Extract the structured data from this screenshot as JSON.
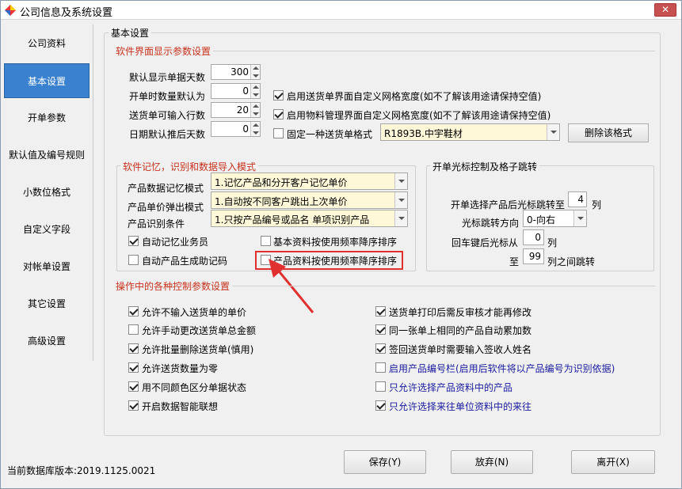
{
  "window": {
    "title": "公司信息及系统设置",
    "close": "✕"
  },
  "nav": [
    "公司资料",
    "基本设置",
    "开单参数",
    "默认值及编号规则",
    "小数位格式",
    "自定义字段",
    "对帐单设置",
    "其它设置",
    "高级设置"
  ],
  "nav_active": "基本设置",
  "main_title": "基本设置",
  "display_section": {
    "title": "软件界面显示参数设置",
    "rows": [
      {
        "label": "默认显示单据天数",
        "value": "300"
      },
      {
        "label": "开单时数量默认为",
        "value": "0"
      },
      {
        "label": "送货单可输入行数",
        "value": "20"
      },
      {
        "label": "日期默认推后天数",
        "value": "0"
      }
    ],
    "checks": [
      {
        "label": "启用送货单界面自定义网格宽度(如不了解该用途请保持空值)",
        "checked": true
      },
      {
        "label": "启用物料管理界面自定义网格宽度(如不了解该用途请保持空值)",
        "checked": true
      },
      {
        "label": "固定一种送货单格式",
        "checked": false
      }
    ],
    "format_value": "R1893B.中宇鞋材",
    "delete_format": "删除该格式"
  },
  "memory_section": {
    "title": "软件记忆，识别和数据导入模式",
    "rows": [
      {
        "label": "产品数据记忆模式",
        "value": "1.记忆产品和分开客户记忆单价"
      },
      {
        "label": "产品单价弹出模式",
        "value": "1.自动按不同客户跳出上次单价"
      },
      {
        "label": "产品识别条件",
        "value": "1.只按产品编号或品名 单项识别产品"
      }
    ],
    "checks": [
      {
        "label": "自动记忆业务员",
        "checked": true
      },
      {
        "label": "基本资料按使用频率降序排序",
        "checked": false
      },
      {
        "label": "自动产品生成助记码",
        "checked": false
      },
      {
        "label": "产品资料按使用频率降序排序",
        "checked": false
      }
    ]
  },
  "cursor_section": {
    "title": "开单光标控制及格子跳转",
    "row1_label": "开单选择产品后光标跳转至",
    "row1_value": "4",
    "row1_unit": "列",
    "row2_label": "光标跳转方向",
    "row2_value": "0-向右",
    "row3_label": "回车键后光标从",
    "row3_value": "0",
    "row3_unit": "列",
    "row4_label": "至",
    "row4_value": "99",
    "row4_unit": "列之间跳转"
  },
  "ops_section": {
    "title": "操作中的各种控制参数设置",
    "left": [
      {
        "label": "允许不输入送货单的单价",
        "checked": true
      },
      {
        "label": "允许手动更改送货单总金额",
        "checked": false
      },
      {
        "label": "允许批量删除送货单(慎用)",
        "checked": true
      },
      {
        "label": "允许送货数量为零",
        "checked": true
      },
      {
        "label": "用不同颜色区分单据状态",
        "checked": true
      },
      {
        "label": "开启数据智能联想",
        "checked": true
      }
    ],
    "right": [
      {
        "label": "送货单打印后需反审核才能再修改",
        "checked": true
      },
      {
        "label": "同一张单上相同的产品自动累加数",
        "checked": true
      },
      {
        "label": "签回送货单时需要输入签收人姓名",
        "checked": true
      },
      {
        "label": "启用产品编号栏(启用后软件将以产品编号为识别依据)",
        "checked": false
      },
      {
        "label": "只允许选择产品资料中的产品",
        "checked": false
      },
      {
        "label": "只允许选择来往单位资料中的来往",
        "checked": true
      }
    ]
  },
  "footer": {
    "status": "当前数据库版本:2019.1125.0021",
    "save": "保存(Y)",
    "abandon": "放弃(N)",
    "exit": "离开(X)"
  }
}
